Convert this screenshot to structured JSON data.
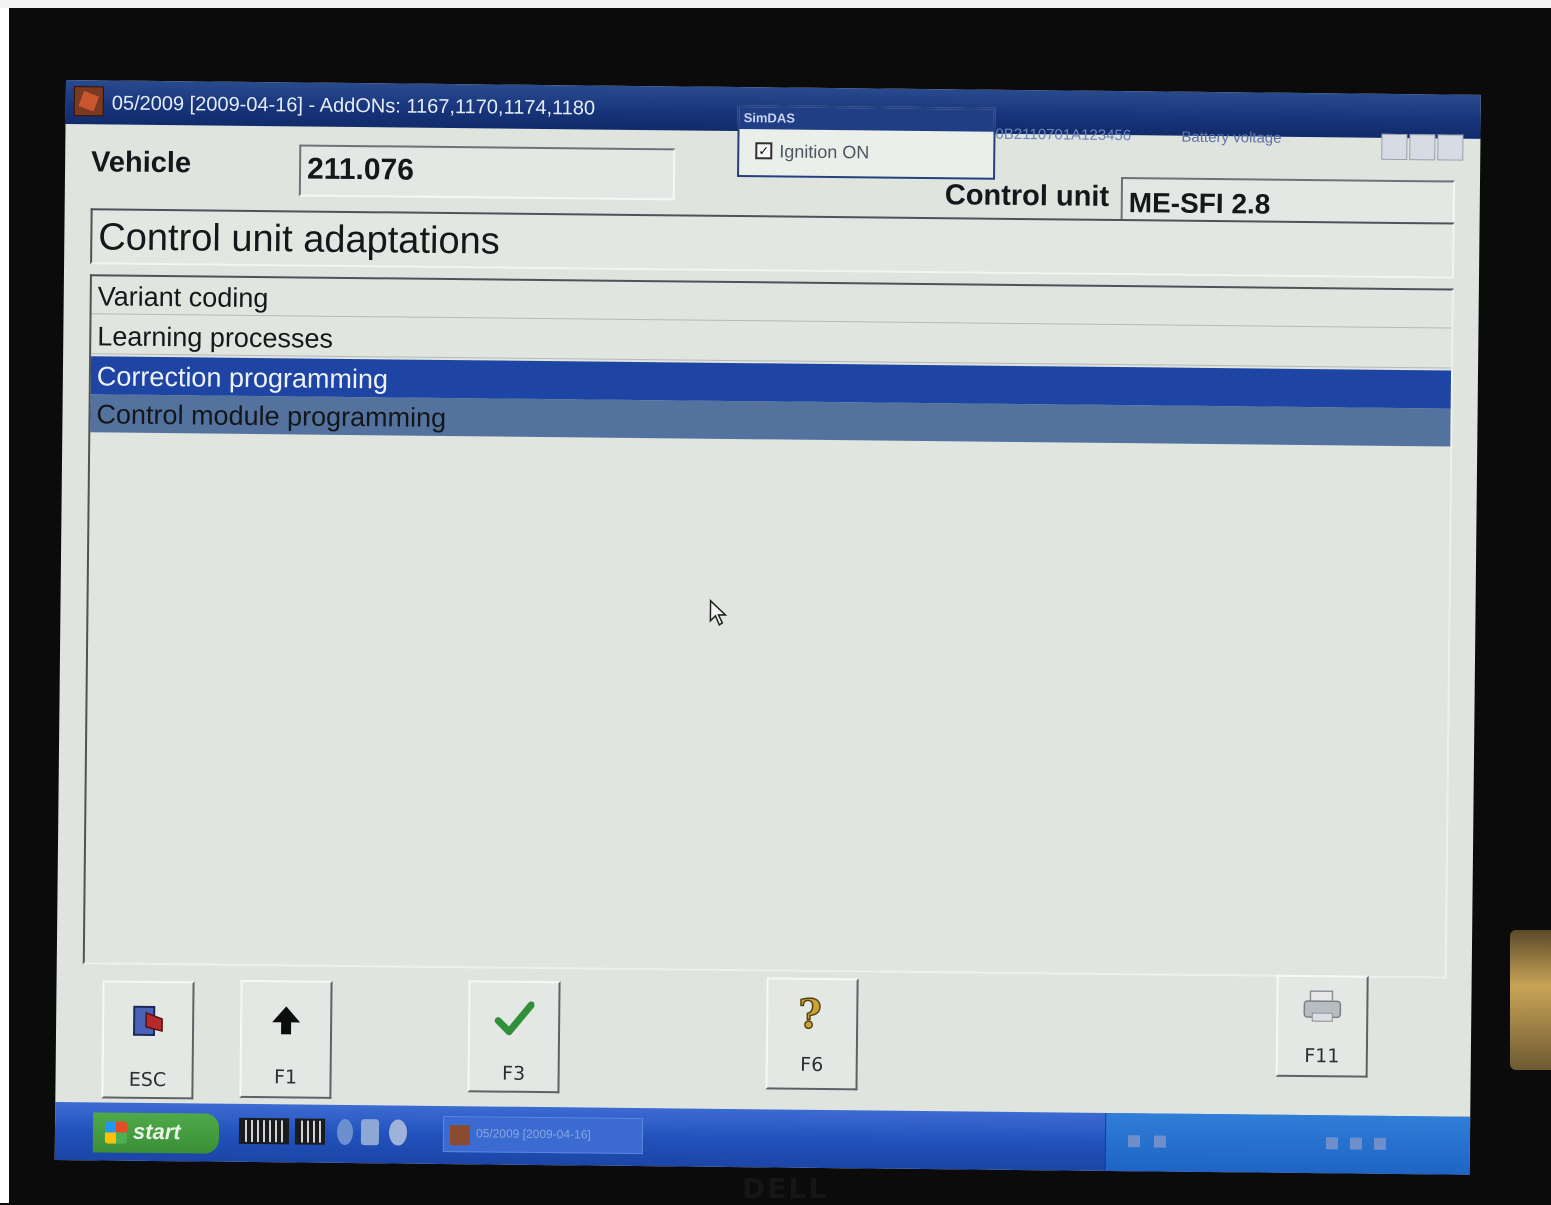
{
  "window": {
    "title": "05/2009 [2009-04-16] - AddONs: 1167,1170,1174,1180",
    "right_text": "0B2110701A123456",
    "battery_label": "Battery voltage"
  },
  "simdas": {
    "title": "SimDAS",
    "ignition_label": "Ignition ON",
    "ignition_checked": true
  },
  "header": {
    "vehicle_label": "Vehicle",
    "vehicle_value": "211.076",
    "control_unit_label": "Control unit",
    "control_unit_value": "ME-SFI 2.8"
  },
  "section": {
    "title": "Control unit adaptations"
  },
  "menu": {
    "items": [
      {
        "label": "Variant coding"
      },
      {
        "label": "Learning processes"
      },
      {
        "label": "Correction programming"
      },
      {
        "label": "Control module programming"
      }
    ],
    "selected_index": 2
  },
  "function_keys": {
    "esc": {
      "label": "ESC",
      "icon": "exit-door-icon"
    },
    "f1": {
      "label": "F1",
      "icon": "arrow-up-icon"
    },
    "f3": {
      "label": "F3",
      "icon": "checkmark-icon"
    },
    "f6": {
      "label": "F6",
      "icon": "help-icon"
    },
    "f11": {
      "label": "F11",
      "icon": "printer-icon"
    }
  },
  "taskbar": {
    "start_label": "start",
    "task_label": "05/2009 [2009-04-16]"
  },
  "monitor": {
    "brand": "DELL"
  },
  "colors": {
    "titlebar": "#17347a",
    "selection": "#1e45a3",
    "window_bg": "#dfe4df",
    "taskbar": "#2252bd"
  }
}
